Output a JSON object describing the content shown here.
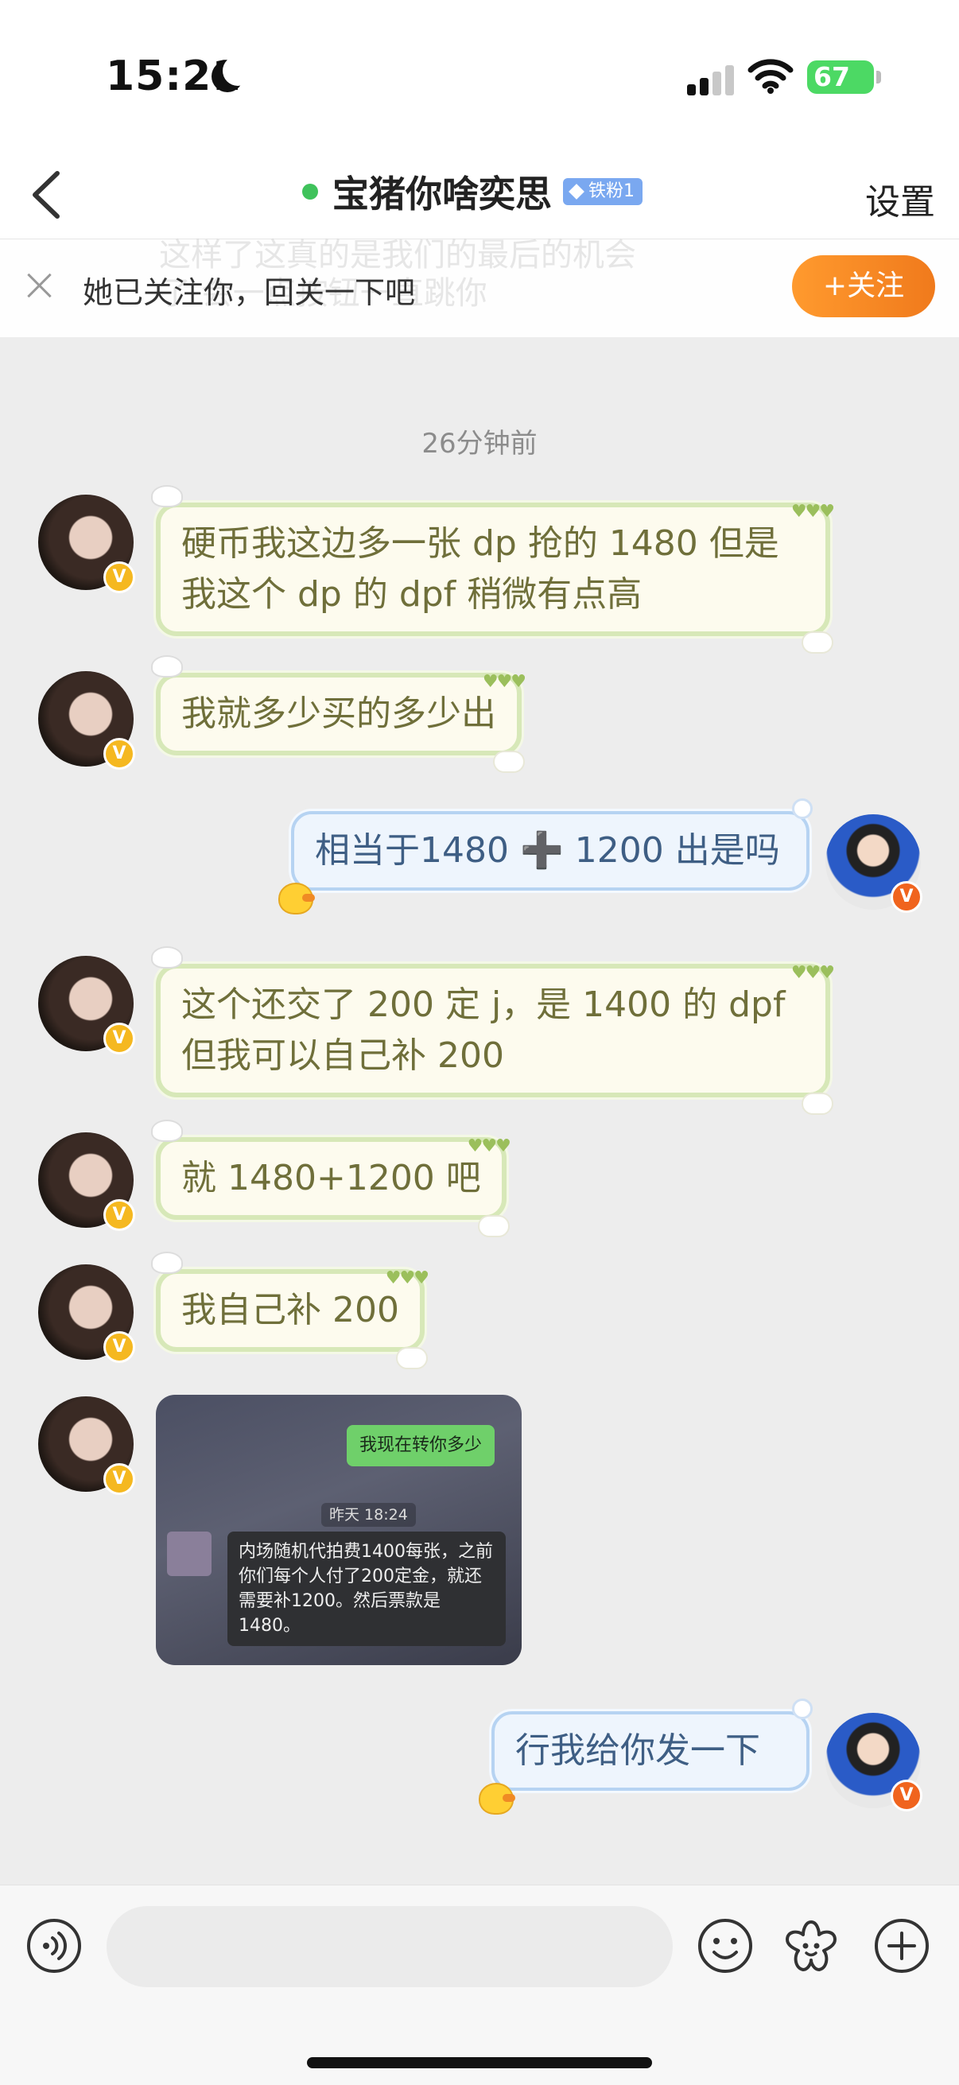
{
  "status_bar": {
    "time": "15:21",
    "battery": "67"
  },
  "header": {
    "title": "宝猪你啥奕思",
    "fan_badge": "铁粉1",
    "settings_label": "设置"
  },
  "follow_banner": {
    "message": "她已关注你，回关一下吧",
    "button_label": "+关注",
    "ghost_line_1": "这样了这真的是我们的最后的机会",
    "ghost_line_2": "了 会一点按钮一直跳你"
  },
  "time_divider": "26分钟前",
  "messages": [
    {
      "side": "left",
      "lines": [
        "硬币我这边多一张 dp 抢的 1480 但是",
        "我这个 dp 的 dpf 稍微有点高"
      ]
    },
    {
      "side": "left",
      "lines": [
        "我就多少买的多少出"
      ]
    },
    {
      "side": "right",
      "lines": [
        "相当于1480 ➕ 1200 出是吗"
      ]
    },
    {
      "side": "left",
      "lines": [
        "这个还交了 200 定 j，是 1400 的 dpf",
        "但我可以自己补 200"
      ]
    },
    {
      "side": "left",
      "lines": [
        "就 1480+1200 吧"
      ]
    },
    {
      "side": "left",
      "lines": [
        "我自己补 200"
      ]
    },
    {
      "side": "left",
      "type": "image",
      "image": {
        "green_bubble": "我现在转你多少",
        "time": "昨天 18:24",
        "dark_bubble": "内场随机代拍费1400每张，之前你们每个人付了200定金，就还需要补1200。然后票款是1480。"
      }
    },
    {
      "side": "right",
      "lines": [
        "行我给你发一下"
      ]
    }
  ],
  "colors": {
    "left_bubble_border": "#d7e8b8",
    "left_bubble_text": "#6f6f3a",
    "right_bubble_border": "#b6d3f2",
    "right_bubble_text": "#3e5e84",
    "follow_button": "#f5871f",
    "online_dot": "#3fc25b"
  },
  "icons": {
    "back": "chevron-left-icon",
    "voice": "voice-icon",
    "emoji": "emoji-icon",
    "sticker": "flower-icon",
    "plus": "plus-circle-icon"
  }
}
